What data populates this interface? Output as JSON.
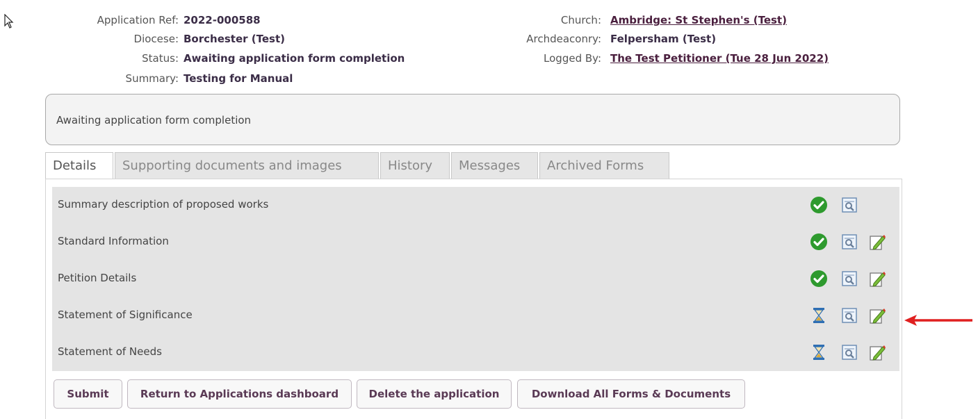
{
  "meta": {
    "application_ref_label": "Application Ref:",
    "application_ref": "2022-000588",
    "diocese_label": "Diocese:",
    "diocese": "Borchester (Test)",
    "status_label": "Status:",
    "status": "Awaiting application form completion",
    "summary_label": "Summary:",
    "summary": "Testing for Manual",
    "church_label": "Church:",
    "church": "Ambridge: St Stephen's (Test)",
    "archdeaconry_label": "Archdeaconry:",
    "archdeaconry": "Felpersham (Test)",
    "logged_by_label": "Logged By:",
    "logged_by": "The Test Petitioner (Tue 28 Jun 2022)"
  },
  "status_box": {
    "text": "Awaiting application form completion"
  },
  "tabs": [
    {
      "label": "Details",
      "active": true
    },
    {
      "label": "Supporting documents and images",
      "active": false
    },
    {
      "label": "History",
      "active": false
    },
    {
      "label": "Messages",
      "active": false
    },
    {
      "label": "Archived Forms",
      "active": false
    }
  ],
  "forms": [
    {
      "label": "Summary description of proposed works",
      "status_icon": "complete-check-icon",
      "editable": false
    },
    {
      "label": "Standard Information",
      "status_icon": "complete-check-icon",
      "editable": true
    },
    {
      "label": "Petition Details",
      "status_icon": "complete-check-icon",
      "editable": true
    },
    {
      "label": "Statement of Significance",
      "status_icon": "pending-hourglass-icon",
      "editable": true
    },
    {
      "label": "Statement of Needs",
      "status_icon": "pending-hourglass-icon",
      "editable": true
    }
  ],
  "buttons": {
    "submit": "Submit",
    "return": "Return to Applications dashboard",
    "delete": "Delete the application",
    "download": "Download All Forms & Documents"
  },
  "colors": {
    "accent": "#4a1f3e",
    "check_green": "#2e9a2e",
    "annotation_arrow": "#e02020"
  }
}
